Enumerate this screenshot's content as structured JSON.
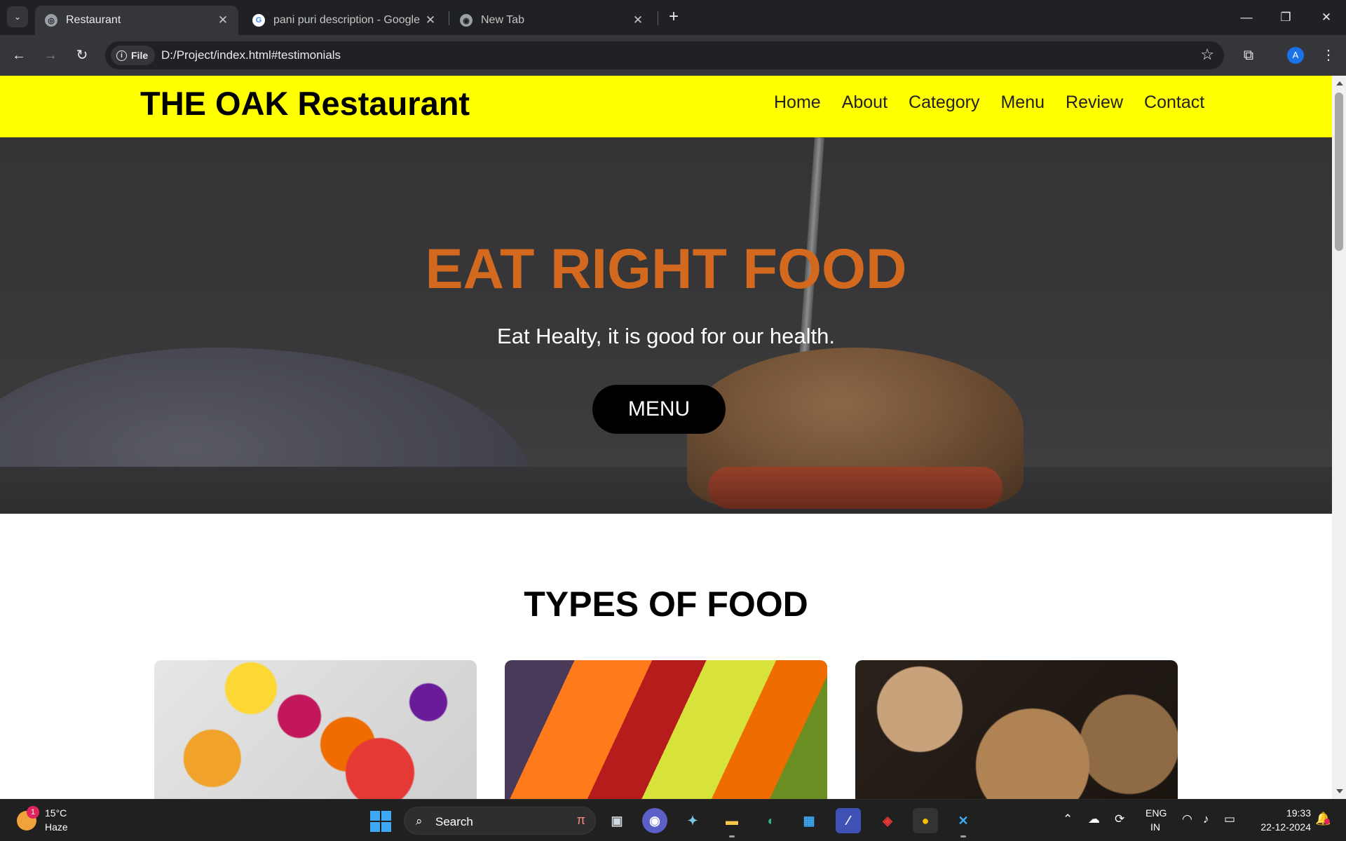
{
  "browser": {
    "tabs": [
      {
        "title": "Restaurant",
        "active": true
      },
      {
        "title": "pani puri description - Google S",
        "active": false
      },
      {
        "title": "New Tab",
        "active": false
      }
    ],
    "omnibox": {
      "chip": "File",
      "url": "D:/Project/index.html#testimonials"
    },
    "profile_initial": "A"
  },
  "site": {
    "logo": "THE OAK Restaurant",
    "nav": [
      "Home",
      "About",
      "Category",
      "Menu",
      "Review",
      "Contact"
    ],
    "hero": {
      "title": "EAT RIGHT FOOD",
      "subtitle": "Eat Healty, it is good for our health.",
      "button": "MENU",
      "title_color": "#d2691e"
    },
    "section_title": "TYPES OF FOOD",
    "header_color": "#ffff00"
  },
  "taskbar": {
    "weather": {
      "temp": "15°C",
      "condition": "Haze",
      "badge": "1"
    },
    "search_label": "Search",
    "lang": [
      "ENG",
      "IN"
    ],
    "time": "19:33",
    "date": "22-12-2024"
  }
}
